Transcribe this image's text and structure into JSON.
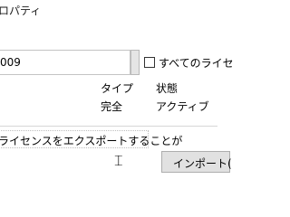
{
  "window": {
    "title": "ロパティ"
  },
  "license_combo": {
    "value": "009"
  },
  "all_licenses_checkbox": {
    "label": "すべてのライセ",
    "checked": false
  },
  "license_info": {
    "type_header": "タイプ",
    "state_header": "状態",
    "type_value": "完全",
    "state_value": "アクティブ"
  },
  "export_message": "ライセンスをエクスポートすることが",
  "import_button": {
    "label": "インポート("
  }
}
